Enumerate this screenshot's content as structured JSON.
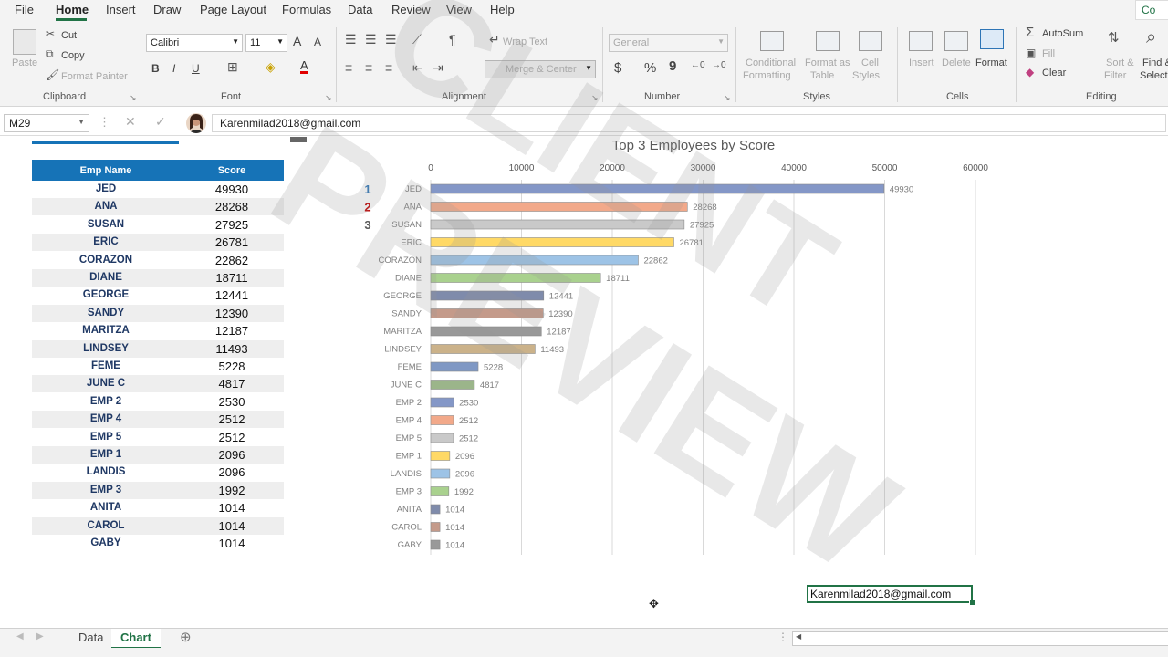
{
  "menu": {
    "items": [
      "File",
      "Home",
      "Insert",
      "Draw",
      "Page Layout",
      "Formulas",
      "Data",
      "Review",
      "View",
      "Help"
    ],
    "active": "Home",
    "comments_label": "Co"
  },
  "ribbon": {
    "clipboard": {
      "paste": "Paste",
      "cut": "Cut",
      "copy": "Copy",
      "format_painter": "Format Painter",
      "label": "Clipboard"
    },
    "font": {
      "name": "Calibri",
      "size": "11",
      "bold": "B",
      "italic": "I",
      "underline": "U",
      "label": "Font",
      "grow": "A",
      "shrink": "A"
    },
    "alignment": {
      "wrap_text": "Wrap Text",
      "merge_center": "Merge & Center",
      "label": "Alignment"
    },
    "number": {
      "format": "General",
      "currency": "$",
      "percent": "%",
      "comma": "9",
      "label": "Number"
    },
    "styles": {
      "conditional": "Conditional",
      "conditional2": "Formatting",
      "format_as": "Format as",
      "format_as2": "Table",
      "cell": "Cell",
      "cell2": "Styles",
      "label": "Styles"
    },
    "cells": {
      "insert": "Insert",
      "delete": "Delete",
      "format": "Format",
      "label": "Cells"
    },
    "editing": {
      "autosum": "AutoSum",
      "fill": "Fill",
      "clear": "Clear",
      "sort": "Sort &",
      "sort2": "Filter",
      "find": "Find &",
      "find2": "Select",
      "label": "Editing"
    }
  },
  "formula_bar": {
    "name_box": "M29",
    "content": "Karenmilad2018@gmail.com"
  },
  "table": {
    "headers": [
      "Emp Name",
      "Score"
    ],
    "rows": [
      [
        "JED",
        "49930"
      ],
      [
        "ANA",
        "28268"
      ],
      [
        "SUSAN",
        "27925"
      ],
      [
        "ERIC",
        "26781"
      ],
      [
        "CORAZON",
        "22862"
      ],
      [
        "DIANE",
        "18711"
      ],
      [
        "GEORGE",
        "12441"
      ],
      [
        "SANDY",
        "12390"
      ],
      [
        "MARITZA",
        "12187"
      ],
      [
        "LINDSEY",
        "11493"
      ],
      [
        "FEME",
        "5228"
      ],
      [
        "JUNE C",
        "4817"
      ],
      [
        "EMP 2",
        "2530"
      ],
      [
        "EMP 4",
        "2512"
      ],
      [
        "EMP 5",
        "2512"
      ],
      [
        "EMP 1",
        "2096"
      ],
      [
        "LANDIS",
        "2096"
      ],
      [
        "EMP 3",
        "1992"
      ],
      [
        "ANITA",
        "1014"
      ],
      [
        "CAROL",
        "1014"
      ],
      [
        "GABY",
        "1014"
      ]
    ]
  },
  "chart_data": {
    "type": "bar",
    "orientation": "horizontal",
    "title": "Top 3 Employees by Score",
    "categories": [
      "JED",
      "ANA",
      "SUSAN",
      "ERIC",
      "CORAZON",
      "DIANE",
      "GEORGE",
      "SANDY",
      "MARITZA",
      "LINDSEY",
      "FEME",
      "JUNE C",
      "EMP 2",
      "EMP 4",
      "EMP 5",
      "EMP 1",
      "LANDIS",
      "EMP 3",
      "ANITA",
      "CAROL",
      "GABY"
    ],
    "values": [
      49930,
      28268,
      27925,
      26781,
      22862,
      18711,
      12441,
      12390,
      12187,
      11493,
      5228,
      4817,
      2530,
      2512,
      2512,
      2096,
      2096,
      1992,
      1014,
      1014,
      1014
    ],
    "xlim": [
      0,
      60000
    ],
    "x_ticks": [
      "0",
      "10000",
      "20000",
      "30000",
      "40000",
      "50000",
      "60000"
    ],
    "x_axis_position": "top",
    "grid": true,
    "rank_labels": [
      "1",
      "2",
      "3"
    ],
    "rank_colors": [
      "#2e75b6",
      "#c00000",
      "#595959"
    ],
    "bar_colors": [
      "#8497c7",
      "#f2a98a",
      "#c9c9c9",
      "#ffd966",
      "#9dc3e6",
      "#a9d18e",
      "#7f8bab",
      "#c49a8a",
      "#999999",
      "#cbb28a",
      "#7f98c4",
      "#9bb58a",
      "#8497c7",
      "#f2a98a",
      "#c9c9c9",
      "#ffd966",
      "#9dc3e6",
      "#a9d18e",
      "#7f8bab",
      "#c49a8a",
      "#999999"
    ]
  },
  "selected_cell_text": "Karenmilad2018@gmail.com",
  "watermark": "CLIENT PREVIEW",
  "sheet_tabs": [
    "Data",
    "Chart"
  ],
  "active_sheet": "Chart"
}
